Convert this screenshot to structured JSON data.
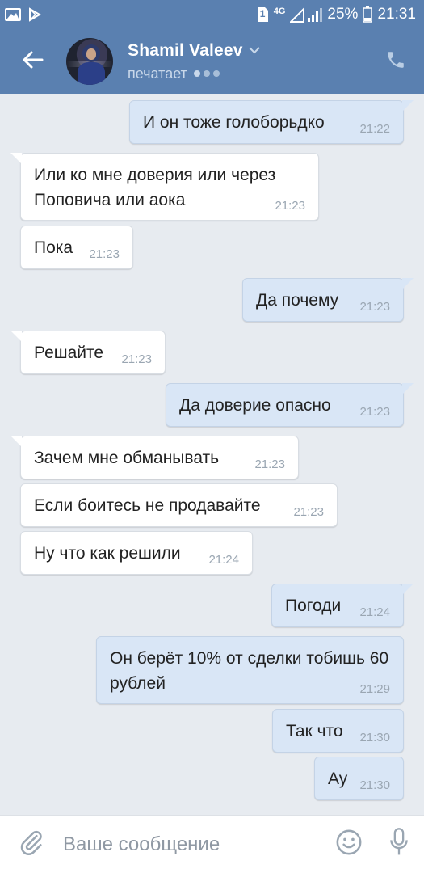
{
  "status_bar": {
    "sim_badge": "1",
    "network": "4G",
    "battery": "25%",
    "time": "21:31",
    "icons": [
      "image-icon",
      "play-store-icon",
      "sim-icon",
      "signal-icon",
      "battery-icon"
    ]
  },
  "header": {
    "contact_name": "Shamil Valeev",
    "status": "печатает",
    "icons": [
      "back-arrow-icon",
      "chevron-down-icon",
      "phone-icon"
    ],
    "accent_color": "#5a80b0"
  },
  "messages": [
    {
      "dir": "out",
      "text": "И он тоже голоборьдко",
      "time": "21:22"
    },
    {
      "dir": "in",
      "text": "Или ко мне доверия или через Поповича или аока",
      "time": "21:23"
    },
    {
      "dir": "in",
      "text": "Пока",
      "time": "21:23"
    },
    {
      "dir": "out",
      "text": "Да почему",
      "time": "21:23"
    },
    {
      "dir": "in",
      "text": "Решайте",
      "time": "21:23"
    },
    {
      "dir": "out",
      "text": "Да доверие опасно",
      "time": "21:23"
    },
    {
      "dir": "in",
      "text": "Зачем мне обманывать",
      "time": "21:23"
    },
    {
      "dir": "in",
      "text": "Если боитесь не продавайте",
      "time": "21:23"
    },
    {
      "dir": "in",
      "text": "Ну что как решили",
      "time": "21:24"
    },
    {
      "dir": "out",
      "text": "Погоди",
      "time": "21:24"
    },
    {
      "dir": "out",
      "text": "Он берёт 10% от сделки тобишь 60 рублей",
      "time": "21:29"
    },
    {
      "dir": "out",
      "text": "Так что",
      "time": "21:30"
    },
    {
      "dir": "out",
      "text": "Ау",
      "time": "21:30"
    }
  ],
  "input_bar": {
    "placeholder": "Ваше сообщение",
    "icons": [
      "paperclip-icon",
      "emoji-icon",
      "microphone-icon"
    ]
  },
  "colors": {
    "incoming_bubble": "#ffffff",
    "outgoing_bubble": "#d9e6f6",
    "chat_background": "#e7ebf0"
  }
}
